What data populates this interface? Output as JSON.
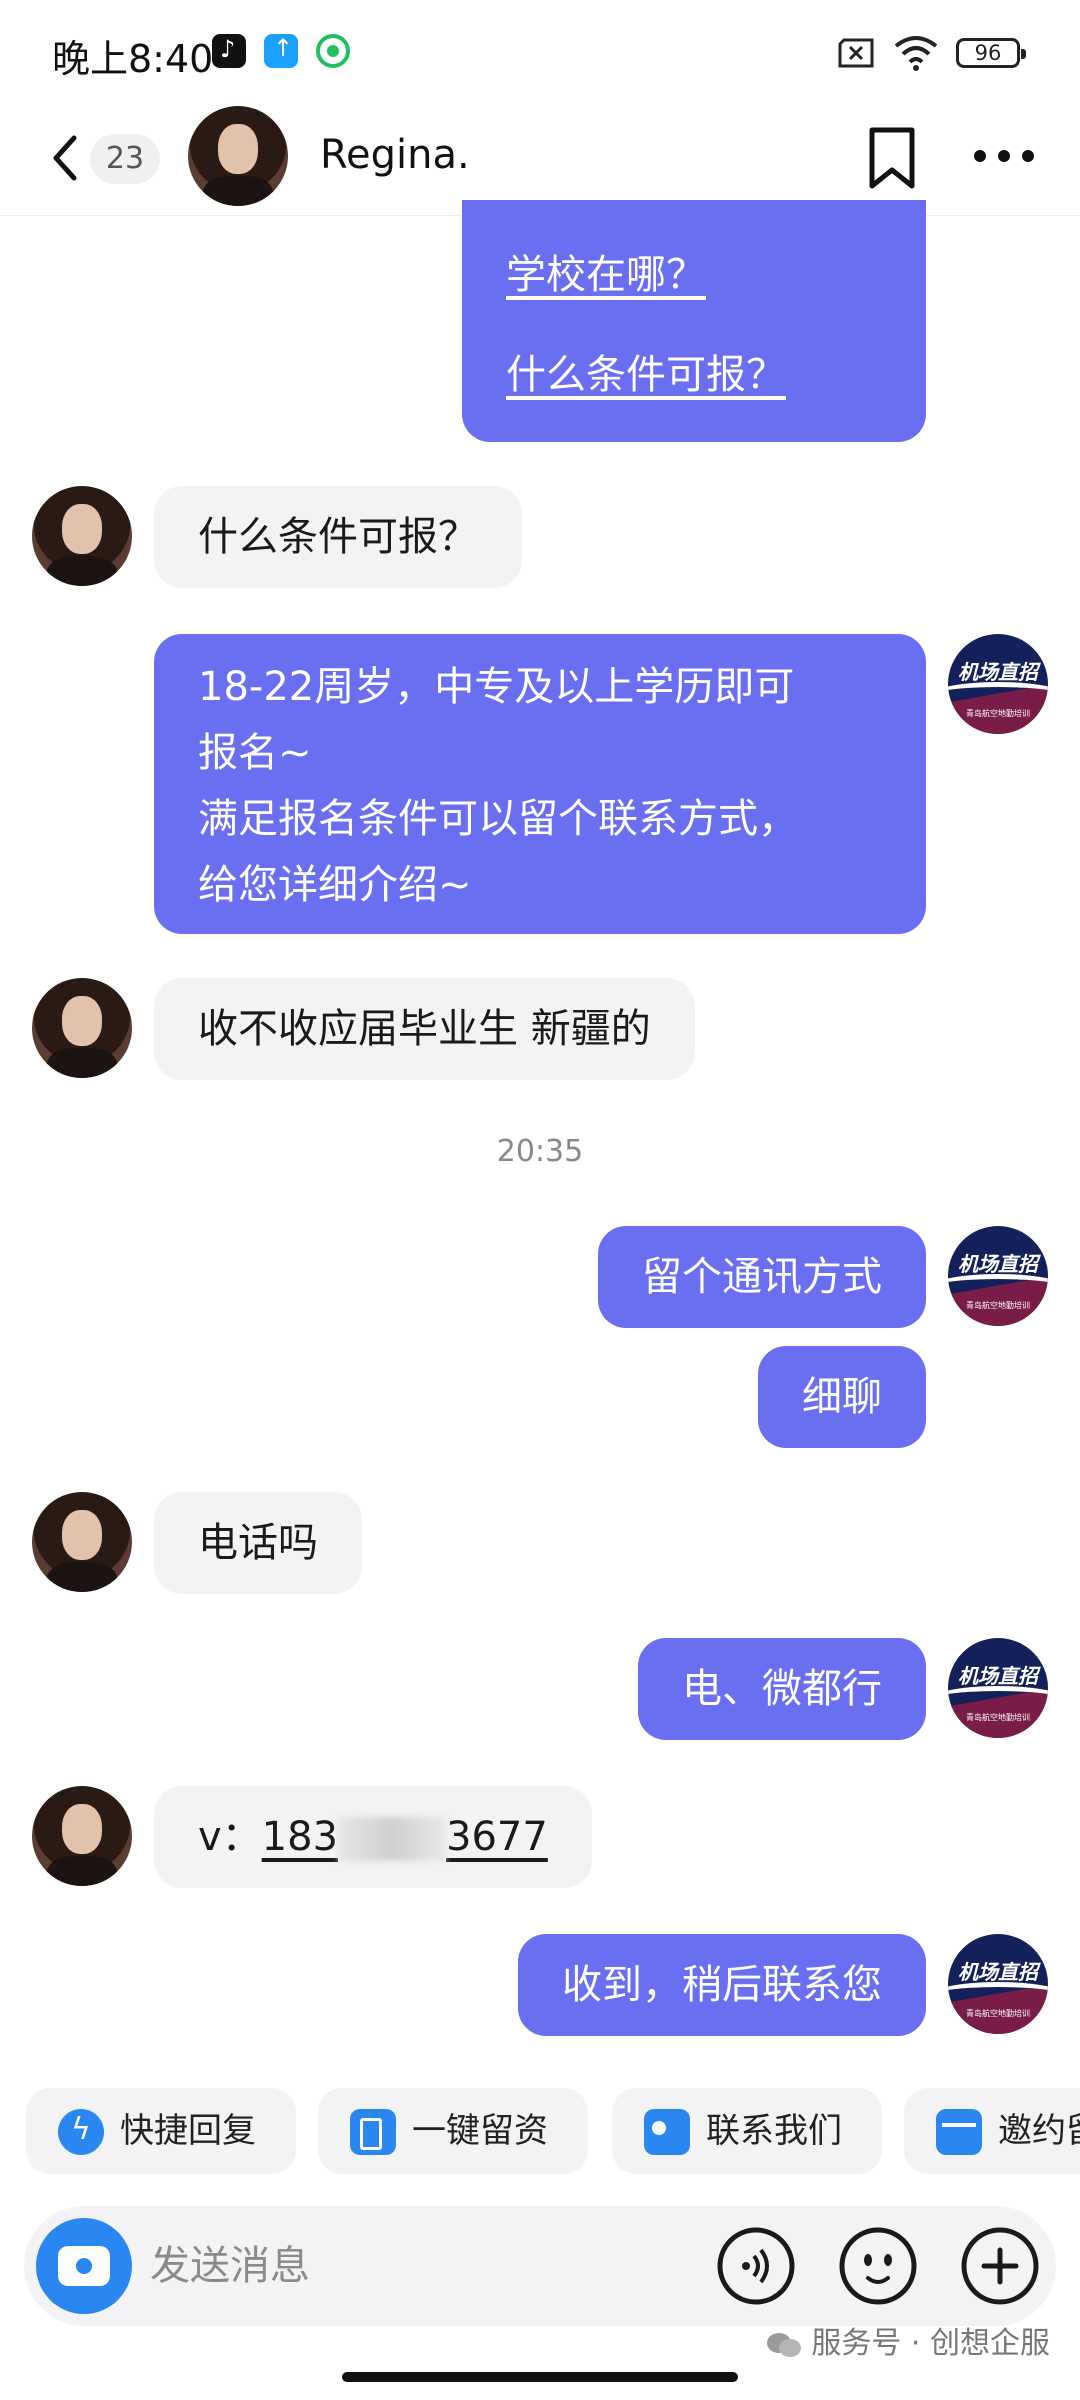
{
  "status_bar": {
    "time": "晚上8:40",
    "battery": "96"
  },
  "header": {
    "unread_count": "23",
    "contact_name": "Regina."
  },
  "messages": [
    {
      "side": "out",
      "lines": [
        "学校在哪？",
        "什么条件可报？"
      ]
    },
    {
      "side": "in",
      "text": "什么条件可报？"
    },
    {
      "side": "out",
      "lines": [
        "18-22周岁，中专及以上学历即可",
        "报名~",
        "满足报名条件可以留个联系方式，",
        "给您详细介绍~"
      ]
    },
    {
      "side": "in",
      "text": "收不收应届毕业生 新疆的"
    },
    {
      "side": "out",
      "text": "留个通讯方式"
    },
    {
      "side": "out",
      "text": "细聊"
    },
    {
      "side": "in",
      "text": "电话吗"
    },
    {
      "side": "out",
      "text": "电、微都行"
    },
    {
      "side": "in",
      "prefix": "v：",
      "phone_start": "183",
      "phone_end": "3677"
    },
    {
      "side": "out",
      "text": "收到，稍后联系您"
    }
  ],
  "time_divider": "20:35",
  "agent": {
    "avatar_title": "机场直招",
    "avatar_subtitle": "青岛航空地勤培训"
  },
  "quick_actions": [
    "快捷回复",
    "一键留资",
    "联系我们",
    "邀约留"
  ],
  "input": {
    "placeholder": "发送消息"
  },
  "watermark": "服务号 · 创想企服",
  "colors": {
    "outgoing_bubble": "#6a6ff2",
    "incoming_bubble": "#f3f3f5",
    "accent": "#2a86f0"
  }
}
